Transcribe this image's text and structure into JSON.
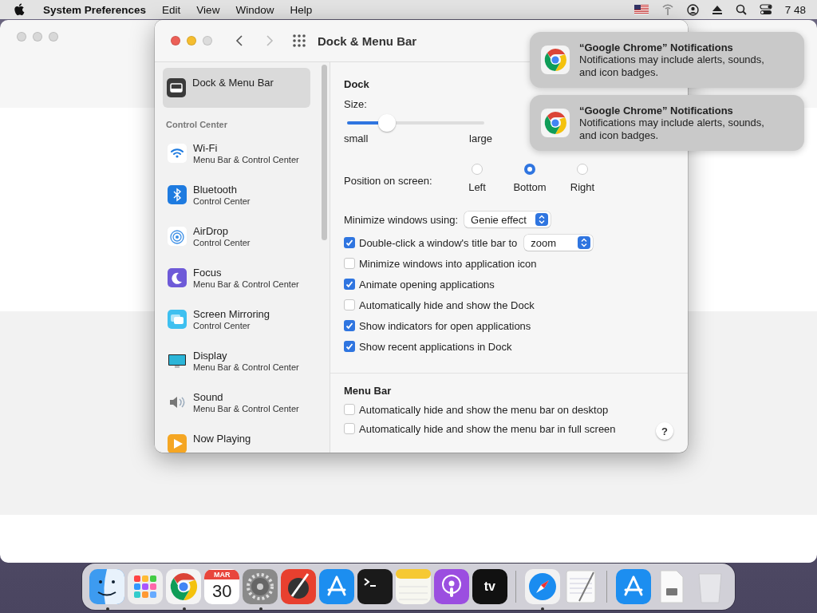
{
  "menu_bar": {
    "app": "System Preferences",
    "menus": [
      "Edit",
      "View",
      "Window",
      "Help"
    ],
    "clock": "7 48"
  },
  "window": {
    "title": "Dock & Menu Bar"
  },
  "sidebar": {
    "top_items": [
      {
        "kind": "dock",
        "title": "Dock & Menu Bar",
        "selected": true
      }
    ],
    "section_title": "Control Center",
    "items": [
      {
        "kind": "wifi",
        "title": "Wi-Fi",
        "subtitle": "Menu Bar & Control Center",
        "selected": false
      },
      {
        "kind": "bluetooth",
        "title": "Bluetooth",
        "subtitle": "Control Center",
        "selected": false
      },
      {
        "kind": "airdrop",
        "title": "AirDrop",
        "subtitle": "Control Center",
        "selected": false
      },
      {
        "kind": "focus",
        "title": "Focus",
        "subtitle": "Menu Bar & Control Center",
        "selected": false
      },
      {
        "kind": "mirroring",
        "title": "Screen Mirroring",
        "subtitle": "Control Center",
        "selected": false
      },
      {
        "kind": "display",
        "title": "Display",
        "subtitle": "Menu Bar & Control Center",
        "selected": false
      },
      {
        "kind": "sound",
        "title": "Sound",
        "subtitle": "Menu Bar & Control Center",
        "selected": false
      },
      {
        "kind": "nowplaying",
        "title": "Now Playing",
        "selected": false
      }
    ]
  },
  "dock_section": {
    "title": "Dock",
    "size": {
      "label": "Size:",
      "level": 0.29,
      "min_label": "small",
      "max_label": "large"
    },
    "position": {
      "label": "Position on screen:",
      "options": [
        {
          "label": "Left",
          "selected": false
        },
        {
          "label": "Bottom",
          "selected": true
        },
        {
          "label": "Right",
          "selected": false
        }
      ]
    },
    "minimize": {
      "label": "Minimize windows using:",
      "value": "Genie effect"
    },
    "checkboxes": [
      {
        "label": "Double-click a window's title bar to",
        "checked": true,
        "value": "zoom"
      },
      {
        "label": "Minimize windows into application icon",
        "checked": false
      },
      {
        "label": "Animate opening applications",
        "checked": true
      },
      {
        "label": "Automatically hide and show the Dock",
        "checked": false
      },
      {
        "label": "Show indicators for open applications",
        "checked": true
      },
      {
        "label": "Show recent applications in Dock",
        "checked": true
      }
    ]
  },
  "menu_bar_section": {
    "title": "Menu Bar",
    "checkboxes": [
      {
        "label": "Automatically hide and show the menu bar on desktop",
        "checked": false
      },
      {
        "label": "Automatically hide and show the menu bar in full screen",
        "checked": false
      }
    ],
    "help": "?"
  },
  "notifications": [
    {
      "title": "“Google Chrome” Notifications",
      "body": "Notifications may include alerts, sounds, and icon badges."
    },
    {
      "title": "“Google Chrome” Notifications",
      "body": "Notifications may include alerts, sounds, and icon badges."
    }
  ],
  "dock": {
    "items": [
      {
        "kind": "finder",
        "running": true
      },
      {
        "kind": "launchpad",
        "running": false
      },
      {
        "kind": "chrome",
        "running": true
      },
      {
        "kind": "calendar",
        "running": false,
        "month": "MAR",
        "day": "30"
      },
      {
        "kind": "settings",
        "running": true
      },
      {
        "kind": "colormeter",
        "running": false
      },
      {
        "kind": "appstore",
        "running": false
      },
      {
        "kind": "terminal",
        "running": false
      },
      {
        "kind": "notes",
        "running": false
      },
      {
        "kind": "podcasts",
        "running": false
      },
      {
        "kind": "tv",
        "running": false,
        "label": "tv"
      },
      {
        "kind": "separator"
      },
      {
        "kind": "safari",
        "running": true
      },
      {
        "kind": "textedit",
        "running": false
      },
      {
        "kind": "separator"
      },
      {
        "kind": "downloads",
        "running": false
      },
      {
        "kind": "file",
        "running": false
      },
      {
        "kind": "trash",
        "running": false
      }
    ]
  }
}
